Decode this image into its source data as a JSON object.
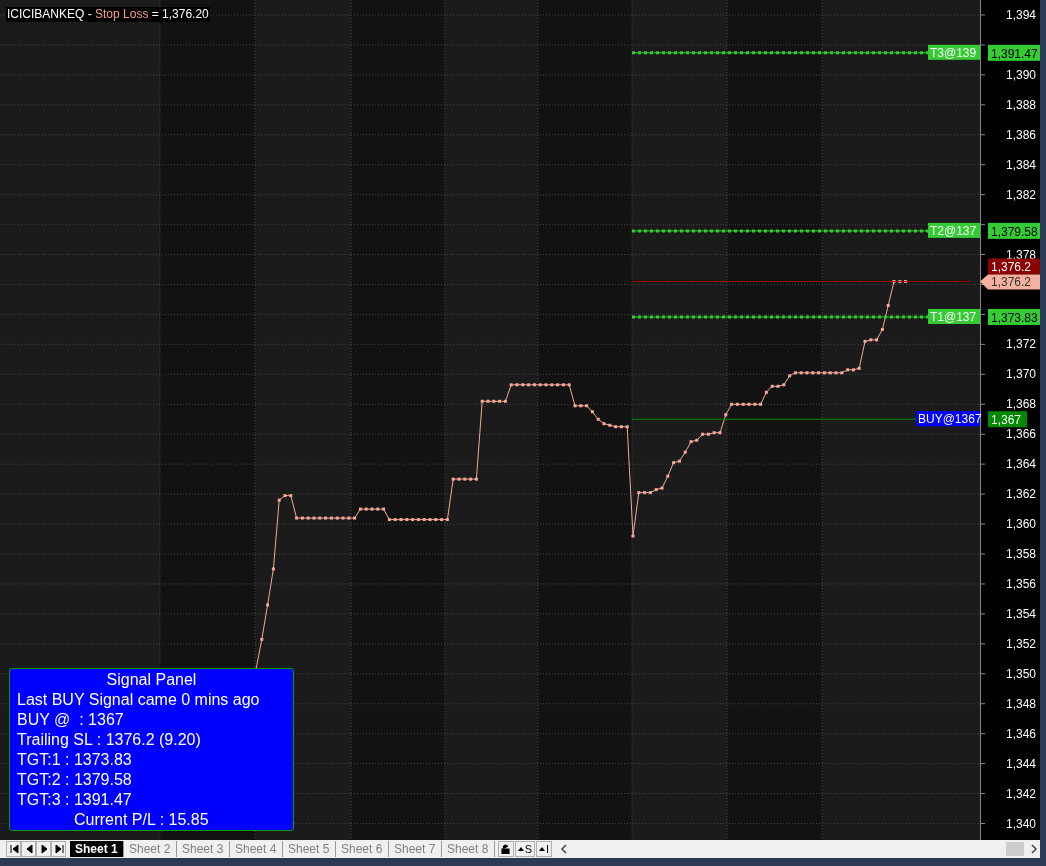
{
  "chart": {
    "title": [
      {
        "kind": "plain",
        "text": "ICICIBANKEQ - "
      },
      {
        "kind": "indicator",
        "text": "Stop Loss"
      },
      {
        "kind": "plain",
        "text": " = 1,376.20"
      }
    ],
    "chart_data": {
      "type": "line",
      "ylim": [
        1338.9,
        1395
      ],
      "grid": true,
      "yticks": [
        {
          "value": 1340,
          "label": "1,340"
        },
        {
          "value": 1342,
          "label": "1,342"
        },
        {
          "value": 1344,
          "label": "1,344"
        },
        {
          "value": 1346,
          "label": "1,346"
        },
        {
          "value": 1348,
          "label": "1,348"
        },
        {
          "value": 1350,
          "label": "1,350"
        },
        {
          "value": 1352,
          "label": "1,352"
        },
        {
          "value": 1354,
          "label": "1,354"
        },
        {
          "value": 1356,
          "label": "1,356"
        },
        {
          "value": 1358,
          "label": "1,358"
        },
        {
          "value": 1360,
          "label": "1,360"
        },
        {
          "value": 1362,
          "label": "1,362"
        },
        {
          "value": 1364,
          "label": "1,364"
        },
        {
          "value": 1366,
          "label": "1,366"
        },
        {
          "value": 1368,
          "label": "1,368"
        },
        {
          "value": 1370,
          "label": "1,370"
        },
        {
          "value": 1372,
          "label": "1,372"
        },
        {
          "value": 1378,
          "label": "1,378"
        },
        {
          "value": 1382,
          "label": "1,382"
        },
        {
          "value": 1384,
          "label": "1,384"
        },
        {
          "value": 1386,
          "label": "1,386"
        },
        {
          "value": 1388,
          "label": "1,388"
        },
        {
          "value": 1390,
          "label": "1,390"
        },
        {
          "value": 1394,
          "label": "1,394"
        }
      ],
      "series": [
        {
          "color": "#f4a898",
          "marker": "square",
          "values": [
            1350.3,
            1352.3,
            1354.6,
            1357,
            1361.6,
            1361.9,
            1361.9,
            1360.4,
            1360.4,
            1360.4,
            1360.4,
            1360.4,
            1360.4,
            1360.4,
            1360.4,
            1360.4,
            1360.4,
            1360.4,
            1361,
            1361,
            1361,
            1361,
            1361,
            1360.3,
            1360.3,
            1360.3,
            1360.3,
            1360.3,
            1360.3,
            1360.3,
            1360.3,
            1360.3,
            1360.3,
            1360.3,
            1363,
            1363,
            1363,
            1363,
            1363,
            1368.2,
            1368.2,
            1368.2,
            1368.2,
            1368.2,
            1369.3,
            1369.3,
            1369.3,
            1369.3,
            1369.3,
            1369.3,
            1369.3,
            1369.3,
            1369.3,
            1369.3,
            1369.3,
            1367.9,
            1367.9,
            1367.9,
            1367.5,
            1367,
            1366.7,
            1366.6,
            1366.5,
            1366.5,
            1366.5,
            1359.2,
            1362.1,
            1362.1,
            1362.1,
            1362.3,
            1362.4,
            1363.2,
            1364.1,
            1364.2,
            1364.8,
            1365.5,
            1365.6,
            1366,
            1366,
            1366.1,
            1366.1,
            1367.3,
            1368,
            1368,
            1368,
            1368,
            1368,
            1368,
            1368.8,
            1369.2,
            1369.2,
            1369.3,
            1369.9,
            1370.1,
            1370.1,
            1370.1,
            1370.1,
            1370.1,
            1370.1,
            1370.1,
            1370.1,
            1370.1,
            1370.3,
            1370.3,
            1370.4,
            1372.2,
            1372.3,
            1372.3,
            1373,
            1374.6,
            1376.2,
            1376.2,
            1376.2
          ]
        }
      ],
      "ref_lines": [
        {
          "axis": "y",
          "value": 1391.47,
          "label": "T3@139",
          "color": "#33cc33"
        },
        {
          "axis": "y",
          "value": 1379.58,
          "label": "T2@137",
          "color": "#33cc33"
        },
        {
          "axis": "y",
          "value": 1376.2,
          "color": "#990000"
        },
        {
          "axis": "y",
          "value": 1373.83,
          "label": "T1@137",
          "color": "#33cc33"
        },
        {
          "axis": "y",
          "value": 1367,
          "label": "BUY@1367",
          "color": "#008800"
        }
      ]
    },
    "axis_tags": [
      {
        "kind": "level",
        "text": "1,391.47",
        "color": "#33cc33"
      },
      {
        "kind": "level",
        "text": "1,379.58",
        "color": "#33cc33"
      },
      {
        "kind": "level",
        "text": "1,376.2",
        "color": "#8b0000"
      },
      {
        "kind": "last",
        "text": "1,376.2",
        "color": "#f4b0a0"
      },
      {
        "kind": "level",
        "text": "1,373.83",
        "color": "#33cc33"
      },
      {
        "kind": "level",
        "text": "1,367",
        "color": "#008800"
      }
    ]
  },
  "signal_panel": {
    "title": "Signal Panel",
    "lines": [
      {
        "kind": "plain",
        "text": "Last BUY Signal came 0 mins ago"
      },
      {
        "kind": "plain",
        "text": "BUY @  : 1367"
      },
      {
        "kind": "plain",
        "text": "Trailing SL : 1376.2 (9.20)"
      },
      {
        "kind": "plain",
        "text": "TGT:1 : 1373.83"
      },
      {
        "kind": "plain",
        "text": "TGT:2 : 1379.58"
      },
      {
        "kind": "plain",
        "text": "TGT:3 : 1391.47"
      },
      {
        "kind": "centered",
        "text": "Current P/L : 15.85"
      }
    ]
  },
  "sheet_tabs": [
    {
      "label": "Sheet 1",
      "selected": true
    },
    {
      "label": "Sheet 2",
      "selected": false
    },
    {
      "label": "Sheet 3",
      "selected": false
    },
    {
      "label": "Sheet 4",
      "selected": false
    },
    {
      "label": "Sheet 5",
      "selected": false
    },
    {
      "label": "Sheet 6",
      "selected": false
    },
    {
      "label": "Sheet 7",
      "selected": false
    },
    {
      "label": "Sheet 8",
      "selected": false
    }
  ],
  "toolbar_buttons": [
    {
      "kind": "lock"
    },
    {
      "kind": "caret",
      "label": "S"
    },
    {
      "kind": "caret",
      "label": "I"
    }
  ]
}
